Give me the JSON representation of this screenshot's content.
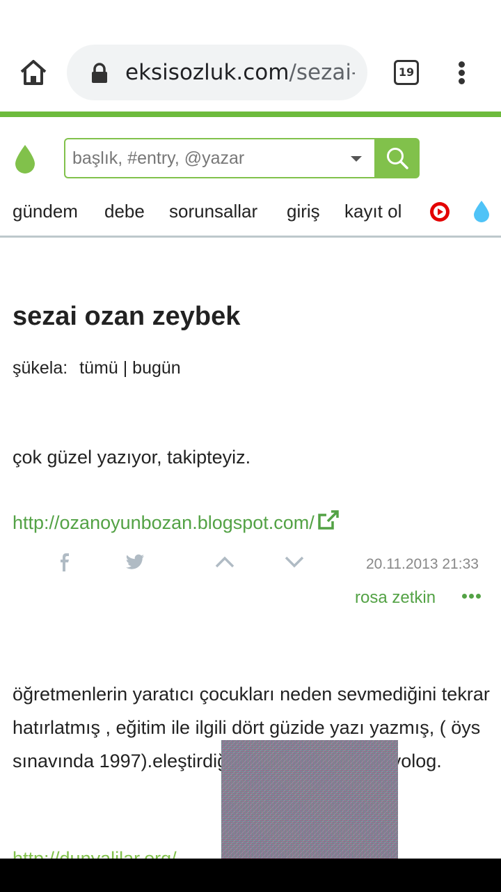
{
  "browser": {
    "url_domain": "eksisozluk.com",
    "url_path": "/sezai-o",
    "tab_count": "19",
    "icons": [
      "home-icon",
      "lock-icon",
      "tabs-icon",
      "more-vert-icon"
    ]
  },
  "header": {
    "search_placeholder": "başlık, #entry, @yazar",
    "accent_color": "#81c14b",
    "icons": [
      "logo-drop-icon",
      "search-icon",
      "dropdown-caret-icon"
    ]
  },
  "nav": {
    "items": [
      "gündem",
      "debe",
      "sorunsallar",
      "giriş",
      "kayıt ol"
    ],
    "icons": [
      "youtube-icon",
      "water-drop-icon"
    ]
  },
  "topic": {
    "title": "sezai ozan zeybek",
    "sukela_label": "şükela:",
    "filter_all": "tümü",
    "filter_sep": "|",
    "filter_today": "bugün"
  },
  "entries": [
    {
      "text": "çok güzel yazıyor, takipteyiz.",
      "link": "http://ozanoyunbozan.blogspot.com/",
      "date": "20.11.2013 21:33",
      "author": "rosa zetkin",
      "icons": [
        "facebook-icon",
        "twitter-icon",
        "upvote-icon",
        "downvote-icon",
        "external-link-icon",
        "more-horiz-icon"
      ]
    },
    {
      "text": "öğretmenlerin yaratıcı çocukları neden sevmediğini tekrar hatırlatmış , eğitim ile ilgili dört güzide yazı yazmış, ( öys sınavında 1997).eleştirdiği sistem ı olmuş sosyolog.",
      "link": "http://dunyalilar.org/"
    }
  ]
}
